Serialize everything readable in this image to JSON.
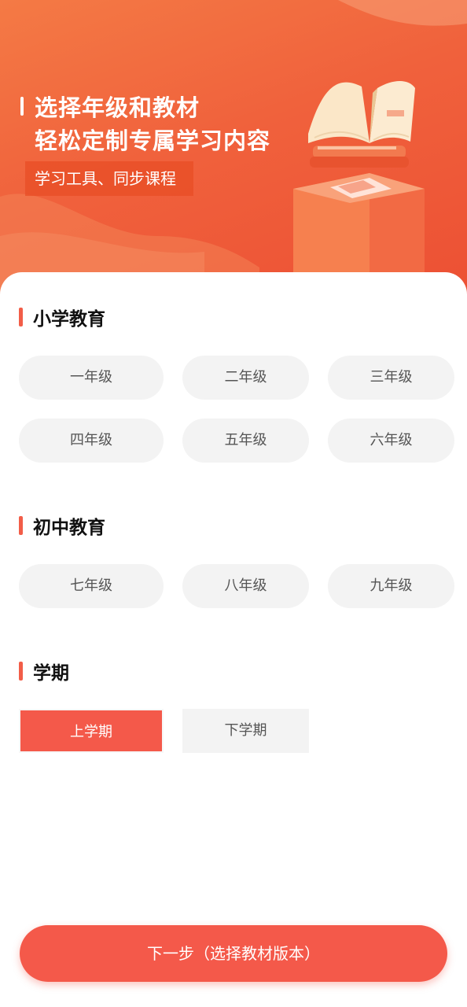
{
  "header": {
    "headline_line1": "选择年级和教材",
    "headline_line2": "轻松定制专属学习内容",
    "tag": "学习工具、同步课程"
  },
  "sections": {
    "primary": {
      "title": "小学教育",
      "grades": [
        "一年级",
        "二年级",
        "三年级",
        "四年级",
        "五年级",
        "六年级"
      ]
    },
    "junior": {
      "title": "初中教育",
      "grades": [
        "七年级",
        "八年级",
        "九年级"
      ]
    },
    "term": {
      "title": "学期",
      "options": [
        "上学期",
        "下学期"
      ],
      "selected": "上学期"
    }
  },
  "next_button": {
    "label": "下一步（选择教材版本）"
  },
  "colors": {
    "accent": "#f4594a",
    "banner_start": "#f47a45",
    "banner_end": "#ec4f33",
    "pill_bg": "#f3f3f3",
    "pill_text": "#555555"
  },
  "icons": {
    "illustration": "open-book-on-pedestal-illustration"
  }
}
